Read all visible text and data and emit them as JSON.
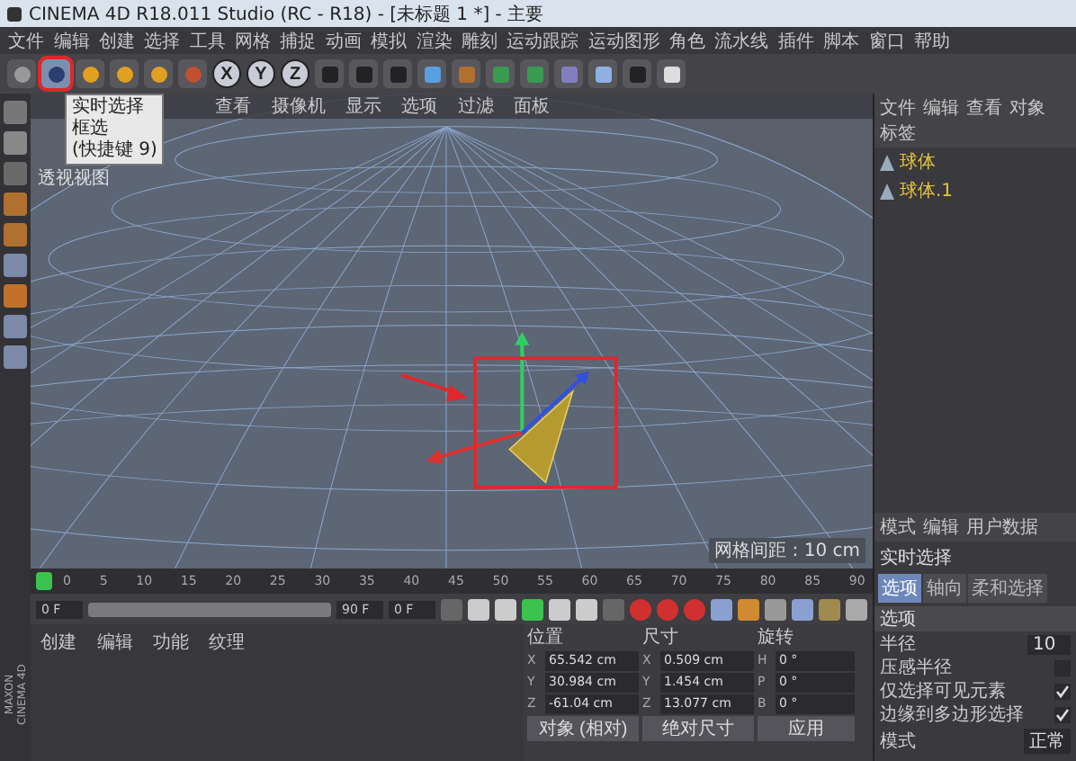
{
  "window": {
    "title": "CINEMA 4D R18.011 Studio (RC - R18) - [未标题 1 *] - 主要"
  },
  "menu": [
    "文件",
    "编辑",
    "创建",
    "选择",
    "工具",
    "网格",
    "捕捉",
    "动画",
    "模拟",
    "渲染",
    "雕刻",
    "运动跟踪",
    "运动图形",
    "角色",
    "流水线",
    "插件",
    "脚本",
    "窗口",
    "帮助"
  ],
  "toolbar": {
    "tools": [
      {
        "kind": "undo",
        "selected": false
      },
      {
        "kind": "live-select",
        "selected": true
      },
      {
        "kind": "move",
        "selected": false
      },
      {
        "kind": "scale",
        "selected": false
      },
      {
        "kind": "rotate",
        "selected": false
      },
      {
        "kind": "pointer",
        "selected": false
      }
    ],
    "axis_buttons": [
      {
        "label": "X",
        "on": true
      },
      {
        "label": "Y",
        "on": true
      },
      {
        "label": "Z",
        "on": true
      }
    ]
  },
  "tooltip": {
    "items": [
      "实时选择",
      "框选",
      "(快捷键 9)"
    ]
  },
  "viewport": {
    "menus": [
      "查看",
      "摄像机",
      "显示",
      "选项",
      "过滤",
      "面板"
    ],
    "label": "透视视图",
    "grid_spacing": "网格间距 : 10 cm"
  },
  "objects_panel": {
    "menus": [
      "文件",
      "编辑",
      "查看",
      "对象",
      "标签"
    ],
    "objects": [
      {
        "name": "球体",
        "selected": false
      },
      {
        "name": "球体.1",
        "selected": false
      }
    ]
  },
  "attributes_panel": {
    "menus": [
      "模式",
      "编辑",
      "用户数据"
    ],
    "title": "实时选择",
    "tabs": [
      {
        "label": "选项",
        "selected": true
      },
      {
        "label": "轴向",
        "selected": false
      },
      {
        "label": "柔和选择",
        "selected": false
      }
    ],
    "section": "选项",
    "fields": [
      {
        "kind": "number",
        "label": "半径",
        "value": "10"
      },
      {
        "kind": "checkbox",
        "label": "压感半径",
        "checked": false
      },
      {
        "kind": "checkbox",
        "label": "仅选择可见元素",
        "checked": true
      },
      {
        "kind": "checkbox",
        "label": "边缘到多边形选择",
        "checked": true
      },
      {
        "kind": "dropdown",
        "label": "模式",
        "value": "正常"
      }
    ]
  },
  "timeline": {
    "ticks": [
      "0",
      "5",
      "10",
      "15",
      "20",
      "25",
      "30",
      "35",
      "40",
      "45",
      "50",
      "55",
      "60",
      "65",
      "70",
      "75",
      "80",
      "85",
      "90"
    ],
    "start": "0 F",
    "end": "90 F",
    "current": "0 F"
  },
  "materials": {
    "menus": [
      "创建",
      "编辑",
      "功能",
      "纹理"
    ]
  },
  "coordinates": {
    "headers": [
      "位置",
      "尺寸",
      "旋转"
    ],
    "rows": [
      {
        "axis": "X",
        "position": "65.542 cm",
        "size_axis": "X",
        "size": "0.509 cm",
        "rot_axis": "H",
        "rotation": "0 °"
      },
      {
        "axis": "Y",
        "position": "30.984 cm",
        "size_axis": "Y",
        "size": "1.454 cm",
        "rot_axis": "P",
        "rotation": "0 °"
      },
      {
        "axis": "Z",
        "position": "-61.04 cm",
        "size_axis": "Z",
        "size": "13.077 cm",
        "rot_axis": "B",
        "rotation": "0 °"
      }
    ],
    "mode": "对象 (相对)",
    "size_mode": "绝对尺寸",
    "apply": "应用"
  },
  "logo": {
    "lines": [
      "MAXON",
      "CINEMA 4D"
    ]
  }
}
